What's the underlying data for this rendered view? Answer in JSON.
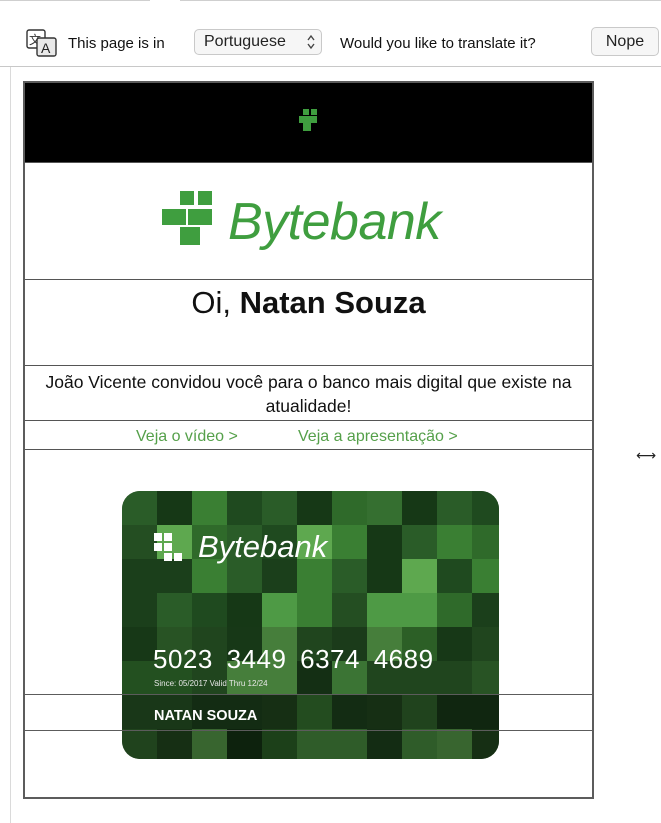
{
  "translate_bar": {
    "prefix": "This page is in",
    "language": "Portuguese",
    "question": "Would you like to translate it?",
    "nope_label": "Nope",
    "icon": "translate-icon"
  },
  "email": {
    "brand_name": "Bytebank",
    "greeting_prefix": "Oi, ",
    "recipient": "Natan Souza",
    "invite_text": "João Vicente convidou você para o banco mais digital que existe na atualidade!",
    "links": {
      "video": "Veja o vídeo >",
      "presentation": "Veja a apresentação >"
    },
    "card": {
      "brand": "Bytebank",
      "number": "5023 3449 6374 4689",
      "dates": "Since: 05/2017  Valid Thru 12/24",
      "holder": "NATAN SOUZA"
    }
  },
  "colors": {
    "brand_green": "#3f9e3f",
    "link_green": "#55a04a",
    "header_black": "#000000"
  },
  "resize_icon": "horizontal-resize-icon"
}
